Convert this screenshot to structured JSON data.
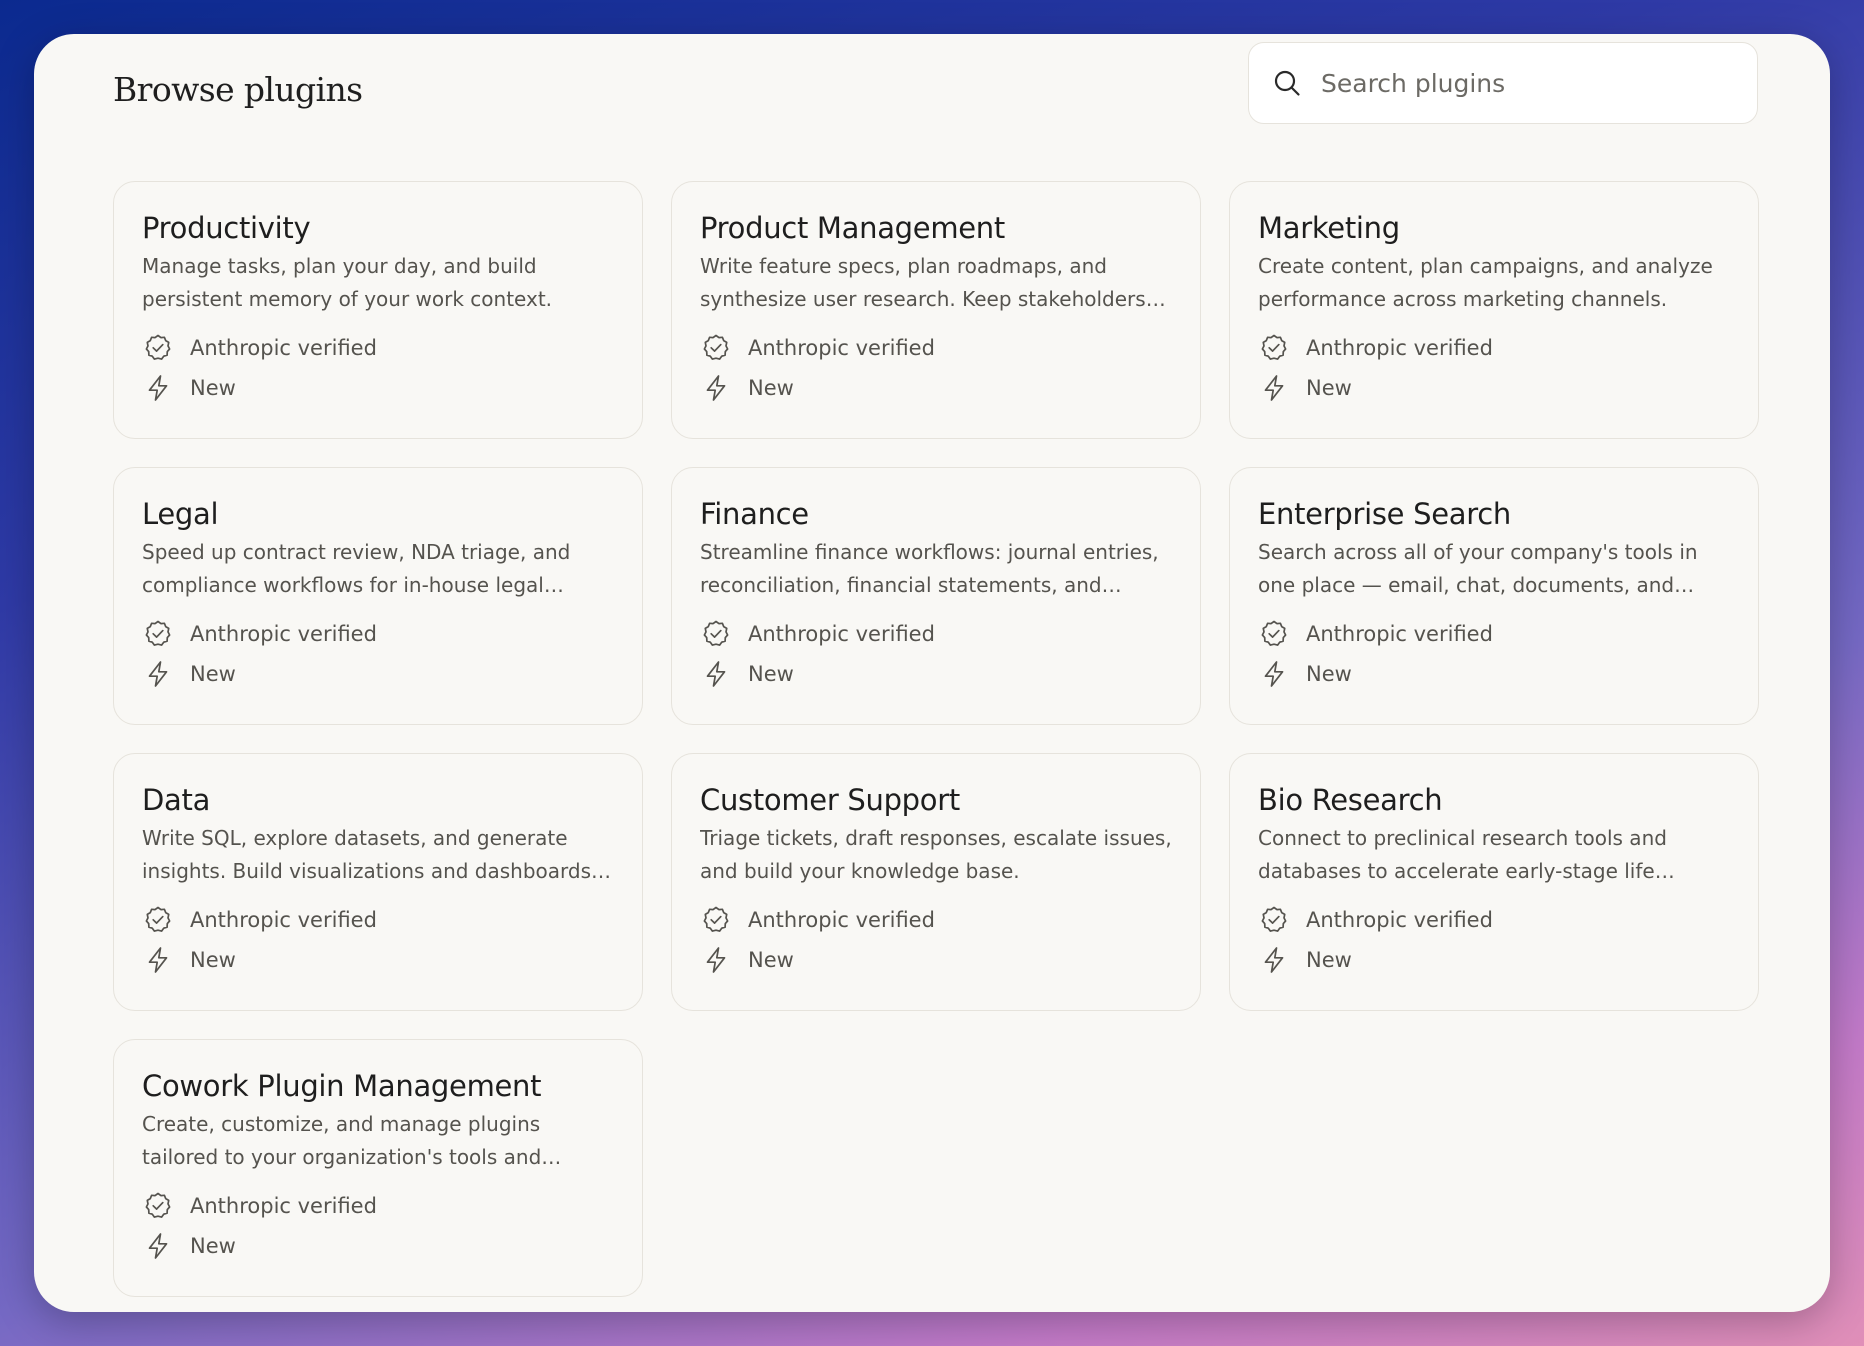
{
  "page": {
    "title": "Browse plugins"
  },
  "search": {
    "placeholder": "Search plugins",
    "icon": "search-icon"
  },
  "badges": {
    "verified_icon": "verified-badge-icon",
    "new_icon": "lightning-bolt-icon"
  },
  "plugins": [
    {
      "title": "Productivity",
      "description": "Manage tasks, plan your day, and build persistent memory of your work context.",
      "verified_label": "Anthropic verified",
      "new_label": "New"
    },
    {
      "title": "Product Management",
      "description": "Write feature specs, plan roadmaps, and synthesize user research. Keep stakeholders…",
      "verified_label": "Anthropic verified",
      "new_label": "New"
    },
    {
      "title": "Marketing",
      "description": "Create content, plan campaigns, and analyze performance across marketing channels.",
      "verified_label": "Anthropic verified",
      "new_label": "New"
    },
    {
      "title": "Legal",
      "description": "Speed up contract review, NDA triage, and compliance workflows for in-house legal teams.",
      "verified_label": "Anthropic verified",
      "new_label": "New"
    },
    {
      "title": "Finance",
      "description": "Streamline finance workflows: journal entries, reconciliation, financial statements, and…",
      "verified_label": "Anthropic verified",
      "new_label": "New"
    },
    {
      "title": "Enterprise Search",
      "description": "Search across all of your company's tools in one place — email, chat, documents, and wikis.",
      "verified_label": "Anthropic verified",
      "new_label": "New"
    },
    {
      "title": "Data",
      "description": "Write SQL, explore datasets, and generate insights. Build visualizations and dashboards…",
      "verified_label": "Anthropic verified",
      "new_label": "New"
    },
    {
      "title": "Customer Support",
      "description": "Triage tickets, draft responses, escalate issues, and build your knowledge base.",
      "verified_label": "Anthropic verified",
      "new_label": "New"
    },
    {
      "title": "Bio Research",
      "description": "Connect to preclinical research tools and databases to accelerate early-stage life…",
      "verified_label": "Anthropic verified",
      "new_label": "New"
    },
    {
      "title": "Cowork Plugin Management",
      "description": "Create, customize, and manage plugins tailored to your organization's tools and workflows.…",
      "verified_label": "Anthropic verified",
      "new_label": "New"
    }
  ]
}
